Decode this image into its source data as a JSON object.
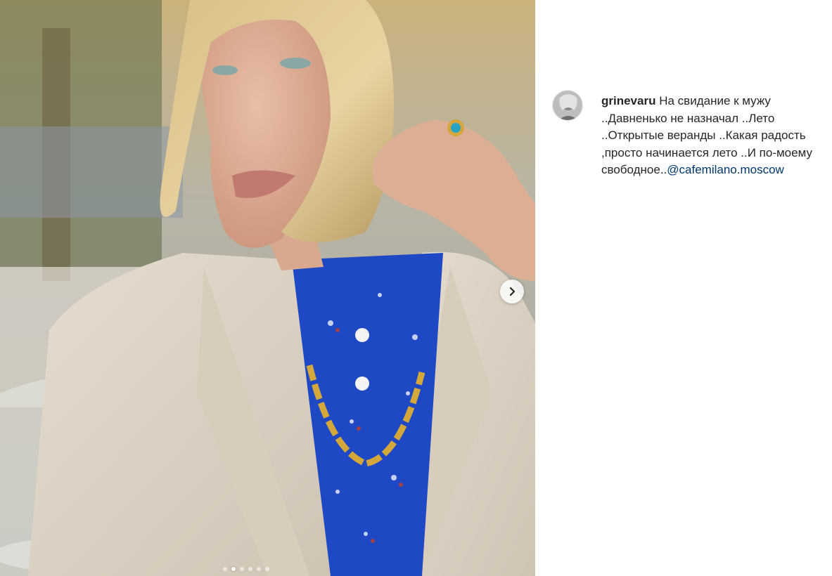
{
  "post": {
    "username": "grinevaru",
    "caption_text": "На свидание к мужу ..Давненько не назначал ..Лето ..Открытые веранды ..Какая радость ,просто начинается лето ..И по-моему свободное..",
    "mention": "@cafemilano.moscow"
  },
  "carousel": {
    "total_slides": 6,
    "active_slide": 2
  },
  "icons": {
    "next": "chevron-right-icon",
    "avatar": "user-avatar"
  },
  "colors": {
    "text": "#262626",
    "link": "#00376b",
    "background": "#ffffff"
  }
}
